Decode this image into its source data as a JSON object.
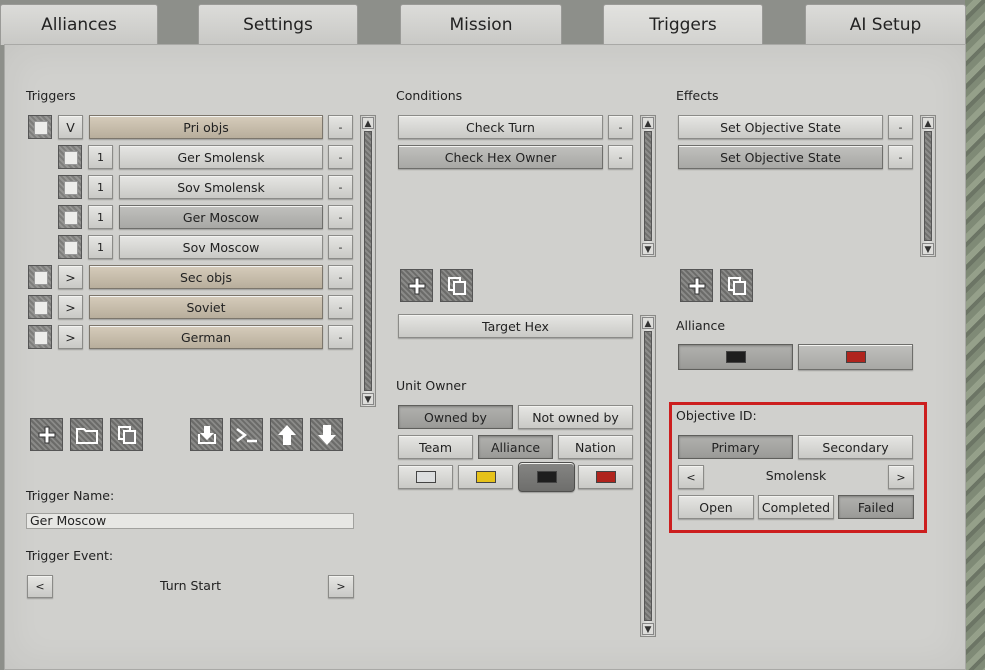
{
  "tabs": [
    "Alliances",
    "Settings",
    "Mission",
    "Triggers",
    "AI Setup"
  ],
  "active_tab": "Triggers",
  "triggers": {
    "label": "Triggers",
    "items": [
      {
        "toggle": "V",
        "label": "Pri objs",
        "style": "tan"
      },
      {
        "toggle": "1",
        "label": "Ger Smolensk",
        "style": "light"
      },
      {
        "toggle": "1",
        "label": "Sov Smolensk",
        "style": "light"
      },
      {
        "toggle": "1",
        "label": "Ger Moscow",
        "style": "selected"
      },
      {
        "toggle": "1",
        "label": "Sov Moscow",
        "style": "light"
      },
      {
        "toggle": ">",
        "label": "Sec objs",
        "style": "tan"
      },
      {
        "toggle": ">",
        "label": "Soviet",
        "style": "tan"
      },
      {
        "toggle": ">",
        "label": "German",
        "style": "tan"
      }
    ],
    "remove_label": "-",
    "toolbar_icons": [
      "add-icon",
      "folder-icon",
      "copy-icon",
      "import-icon",
      "console-icon",
      "arrow-up-icon",
      "arrow-down-icon"
    ]
  },
  "trigger_name": {
    "label": "Trigger Name:",
    "value": "Ger Moscow"
  },
  "trigger_event": {
    "label": "Trigger Event:",
    "value": "Turn Start",
    "prev": "<",
    "next": ">"
  },
  "conditions": {
    "label": "Conditions",
    "items": [
      "Check Turn",
      "Check Hex Owner"
    ],
    "remove_label": "-"
  },
  "condition_detail": {
    "target_button": "Target Hex",
    "unit_owner_label": "Unit Owner",
    "owned_by": "Owned by",
    "not_owned_by": "Not owned by",
    "team": "Team",
    "alliance": "Alliance",
    "nation": "Nation",
    "colors": [
      "#dcdedf",
      "#e6c21a",
      "#1e1e1e",
      "#b0241d"
    ]
  },
  "effects": {
    "label": "Effects",
    "items": [
      "Set Objective State",
      "Set Objective State"
    ],
    "remove_label": "-"
  },
  "alliance": {
    "label": "Alliance",
    "colors": [
      "#1e1e1e",
      "#b0241d"
    ]
  },
  "objective": {
    "label": "Objective ID:",
    "primary": "Primary",
    "secondary": "Secondary",
    "prev": "<",
    "next": ">",
    "name": "Smolensk",
    "states": [
      "Open",
      "Completed",
      "Failed"
    ],
    "selected_state": "Failed"
  },
  "colors": {
    "highlight": "#cc1e1e"
  }
}
